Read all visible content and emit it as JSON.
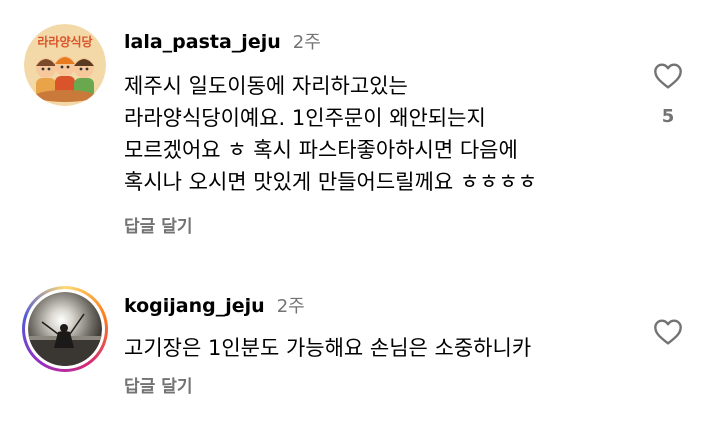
{
  "comments": [
    {
      "username": "lala_pasta_jeju",
      "timestamp": "2주",
      "avatar_text": "라라양식당",
      "body_lines": [
        "제주시 일도이동에 자리하고있는",
        "라라양식당이예요.  1인주문이 왜안되는지",
        "모르겠어요 ㅎ 혹시 파스타좋아하시면 다음에",
        "혹시나 오시면 맛있게 만들어드릴께요 ㅎㅎㅎㅎ"
      ],
      "reply_label": "답글 달기",
      "like_count": "5",
      "like_icon": "heart-outline-icon"
    },
    {
      "username": "kogijang_jeju",
      "timestamp": "2주",
      "body_lines": [
        "고기장은 1인분도 가능해요  손님은 소중하니카"
      ],
      "reply_label": "답글 달기",
      "like_icon": "heart-outline-icon"
    }
  ],
  "colors": {
    "text": "#000000",
    "secondary_text": "#737373",
    "story_ring": [
      "#feda75",
      "#fa7e1e",
      "#d62976",
      "#962fbf",
      "#4f5bd5"
    ]
  }
}
